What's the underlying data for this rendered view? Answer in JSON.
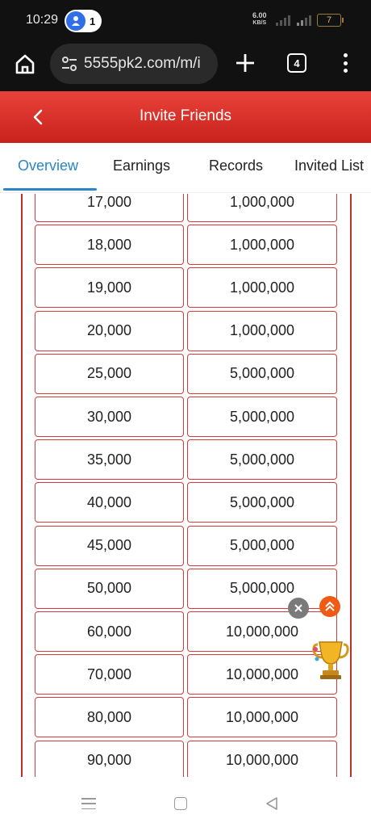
{
  "status_bar": {
    "time": "10:29",
    "hotspot_count": "1",
    "net_speed_value": "6.00",
    "net_speed_unit": "KB/S",
    "battery_level": "7"
  },
  "browser": {
    "url": "5555pk2.com/m/i",
    "tab_count": "4"
  },
  "header": {
    "title": "Invite Friends",
    "color": "#d8322b"
  },
  "tabs": [
    {
      "label": "Overview",
      "active": true
    },
    {
      "label": "Earnings",
      "active": false
    },
    {
      "label": "Records",
      "active": false
    },
    {
      "label": "Invited List",
      "active": false
    }
  ],
  "table": {
    "rows": [
      [
        "17,000",
        "1,000,000"
      ],
      [
        "18,000",
        "1,000,000"
      ],
      [
        "19,000",
        "1,000,000"
      ],
      [
        "20,000",
        "1,000,000"
      ],
      [
        "25,000",
        "5,000,000"
      ],
      [
        "30,000",
        "5,000,000"
      ],
      [
        "35,000",
        "5,000,000"
      ],
      [
        "40,000",
        "5,000,000"
      ],
      [
        "45,000",
        "5,000,000"
      ],
      [
        "50,000",
        "5,000,000"
      ],
      [
        "60,000",
        "10,000,000"
      ],
      [
        "70,000",
        "10,000,000"
      ],
      [
        "80,000",
        "10,000,000"
      ],
      [
        "90,000",
        "10,000,000"
      ]
    ]
  },
  "colors": {
    "accent": "#2a86c8",
    "border_red": "#d43b3b",
    "float_up": "#f05a14"
  }
}
